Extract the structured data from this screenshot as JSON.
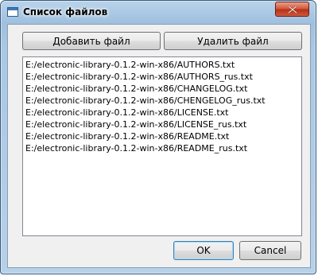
{
  "window": {
    "title": "Список файлов"
  },
  "toolbar": {
    "add_label": "Добавить файл",
    "remove_label": "Удалить файл"
  },
  "files": [
    "E:/electronic-library-0.1.2-win-x86/AUTHORS.txt",
    "E:/electronic-library-0.1.2-win-x86/AUTHORS_rus.txt",
    "E:/electronic-library-0.1.2-win-x86/CHANGELOG.txt",
    "E:/electronic-library-0.1.2-win-x86/CHENGELOG_rus.txt",
    "E:/electronic-library-0.1.2-win-x86/LICENSE.txt",
    "E:/electronic-library-0.1.2-win-x86/LICENSE_rus.txt",
    "E:/electronic-library-0.1.2-win-x86/README.txt",
    "E:/electronic-library-0.1.2-win-x86/README_rus.txt"
  ],
  "footer": {
    "ok_label": "OK",
    "cancel_label": "Cancel"
  },
  "icons": {
    "window": "window-icon",
    "close": "close-icon"
  },
  "colors": {
    "title_bar": "#a9c8e3",
    "close_button": "#c84428",
    "dialog_background": "#f0f0f0"
  }
}
